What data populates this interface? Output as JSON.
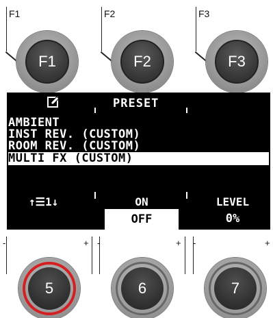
{
  "function_keys": [
    {
      "label": "F1",
      "button_text": "F1"
    },
    {
      "label": "F2",
      "button_text": "F2"
    },
    {
      "label": "F3",
      "button_text": "F3"
    }
  ],
  "screen": {
    "header_title": "PRESET",
    "edit_icon": "edit-icon",
    "items": [
      {
        "label": "AMBIENT",
        "selected": false
      },
      {
        "label": "INST REV. (CUSTOM)",
        "selected": false
      },
      {
        "label": "ROOM REV. (CUSTOM)",
        "selected": false
      },
      {
        "label": "MULTI FX (CUSTOM)",
        "selected": true
      }
    ],
    "softkeys": {
      "nav_label": "↑☰1↓",
      "toggle_on": "ON",
      "toggle_off": "OFF",
      "level_label": "LEVEL",
      "level_value": "0%"
    }
  },
  "knobs": [
    {
      "number": "5",
      "minus": "-",
      "plus": "+",
      "active": true
    },
    {
      "number": "6",
      "minus": "-",
      "plus": "+",
      "active": false
    },
    {
      "number": "7",
      "minus": "-",
      "plus": "+",
      "active": false
    }
  ],
  "colors": {
    "active_ring": "#d42020",
    "screen_bg": "#000000"
  }
}
